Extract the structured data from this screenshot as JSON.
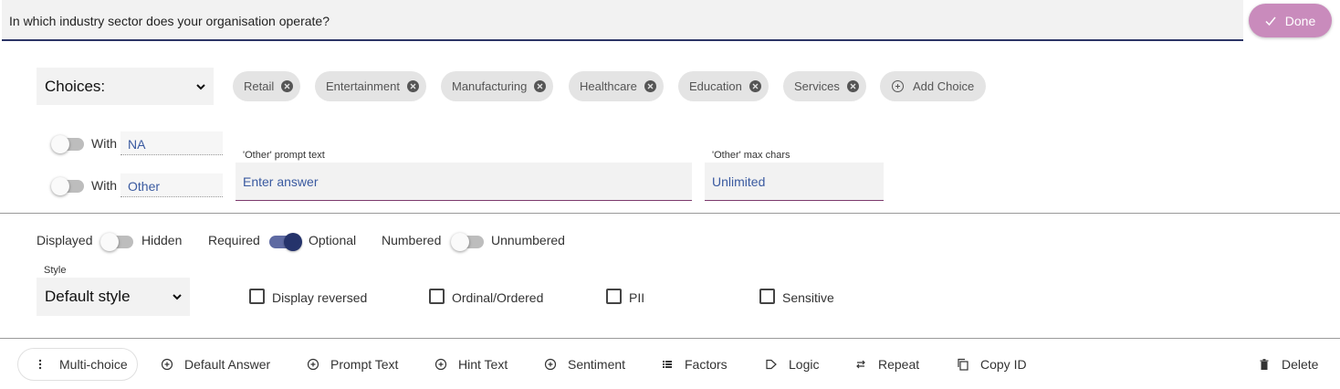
{
  "question": {
    "text": "In which industry sector does your organisation operate?"
  },
  "done_button": {
    "label": "Done"
  },
  "choices_select": {
    "value": "Choices:"
  },
  "choices": [
    "Retail",
    "Entertainment",
    "Manufacturing",
    "Healthcare",
    "Education",
    "Services"
  ],
  "add_choice": {
    "label": "Add Choice"
  },
  "with_na": {
    "label": "With",
    "value": "NA",
    "enabled": false
  },
  "with_other": {
    "label": "With",
    "value": "Other",
    "enabled": false
  },
  "other_prompt": {
    "label": "'Other' prompt text",
    "placeholder": "Enter answer"
  },
  "other_max": {
    "label": "'Other' max chars",
    "value": "Unlimited"
  },
  "visibility": {
    "left": "Displayed",
    "right": "Hidden",
    "on": false
  },
  "requirement": {
    "left": "Required",
    "right": "Optional",
    "on": true
  },
  "numbering": {
    "left": "Numbered",
    "right": "Unnumbered",
    "on": false
  },
  "style": {
    "label": "Style",
    "value": "Default style"
  },
  "checkboxes": {
    "display_reversed": "Display reversed",
    "ordinal": "Ordinal/Ordered",
    "pii": "PII",
    "sensitive": "Sensitive"
  },
  "toolbar": {
    "multi_choice": "Multi-choice",
    "default_answer": "Default Answer",
    "prompt_text": "Prompt Text",
    "hint_text": "Hint Text",
    "sentiment": "Sentiment",
    "factors": "Factors",
    "logic": "Logic",
    "repeat": "Repeat",
    "copy_id": "Copy ID",
    "delete": "Delete"
  },
  "colors": {
    "accent": "#c98bbc",
    "primary": "#25336b",
    "underline": "#7c3b6d"
  }
}
